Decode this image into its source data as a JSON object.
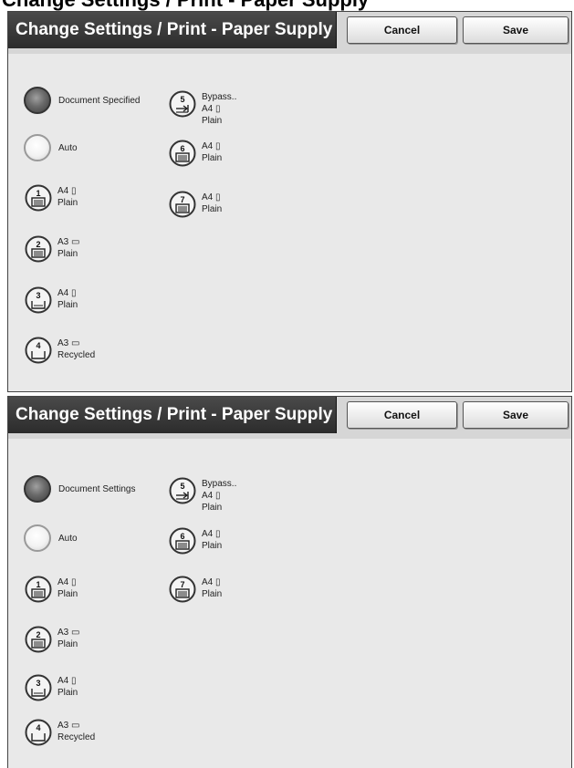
{
  "caption": "Change Settings / Print - Paper Supply",
  "panels": [
    {
      "title": "Change Settings / Print - Paper Supply",
      "cancel_label": "Cancel",
      "save_label": "Save",
      "option_document": "Document Specified",
      "option_auto": "Auto",
      "selected": "document",
      "trays": [
        {
          "number": "1",
          "line1": "A4",
          "line2": "Plain",
          "line3": ""
        },
        {
          "number": "2",
          "line1": "A3",
          "line2": "Plain",
          "line3": ""
        },
        {
          "number": "3",
          "line1": "A4",
          "line2": "Plain",
          "line3": ""
        },
        {
          "number": "4",
          "line1": "A3",
          "line2": "Recycled",
          "line3": ""
        },
        {
          "number": "5",
          "line1": "Bypass..",
          "line2": "A4",
          "line3": "Plain"
        },
        {
          "number": "6",
          "line1": "A4",
          "line2": "Plain",
          "line3": ""
        },
        {
          "number": "7",
          "line1": "A4",
          "line2": "Plain",
          "line3": ""
        }
      ]
    },
    {
      "title": "Change Settings / Print - Paper Supply",
      "cancel_label": "Cancel",
      "save_label": "Save",
      "option_document": "Document Settings",
      "option_auto": "Auto",
      "selected": "document",
      "trays": [
        {
          "number": "1",
          "line1": "A4",
          "line2": "Plain",
          "line3": ""
        },
        {
          "number": "2",
          "line1": "A3",
          "line2": "Plain",
          "line3": ""
        },
        {
          "number": "3",
          "line1": "A4",
          "line2": "Plain",
          "line3": ""
        },
        {
          "number": "4",
          "line1": "A3",
          "line2": "Recycled",
          "line3": ""
        },
        {
          "number": "5",
          "line1": "Bypass..",
          "line2": "A4",
          "line3": "Plain"
        },
        {
          "number": "6",
          "line1": "A4",
          "line2": "Plain",
          "line3": ""
        },
        {
          "number": "7",
          "line1": "A4",
          "line2": "Plain",
          "line3": ""
        }
      ]
    }
  ]
}
